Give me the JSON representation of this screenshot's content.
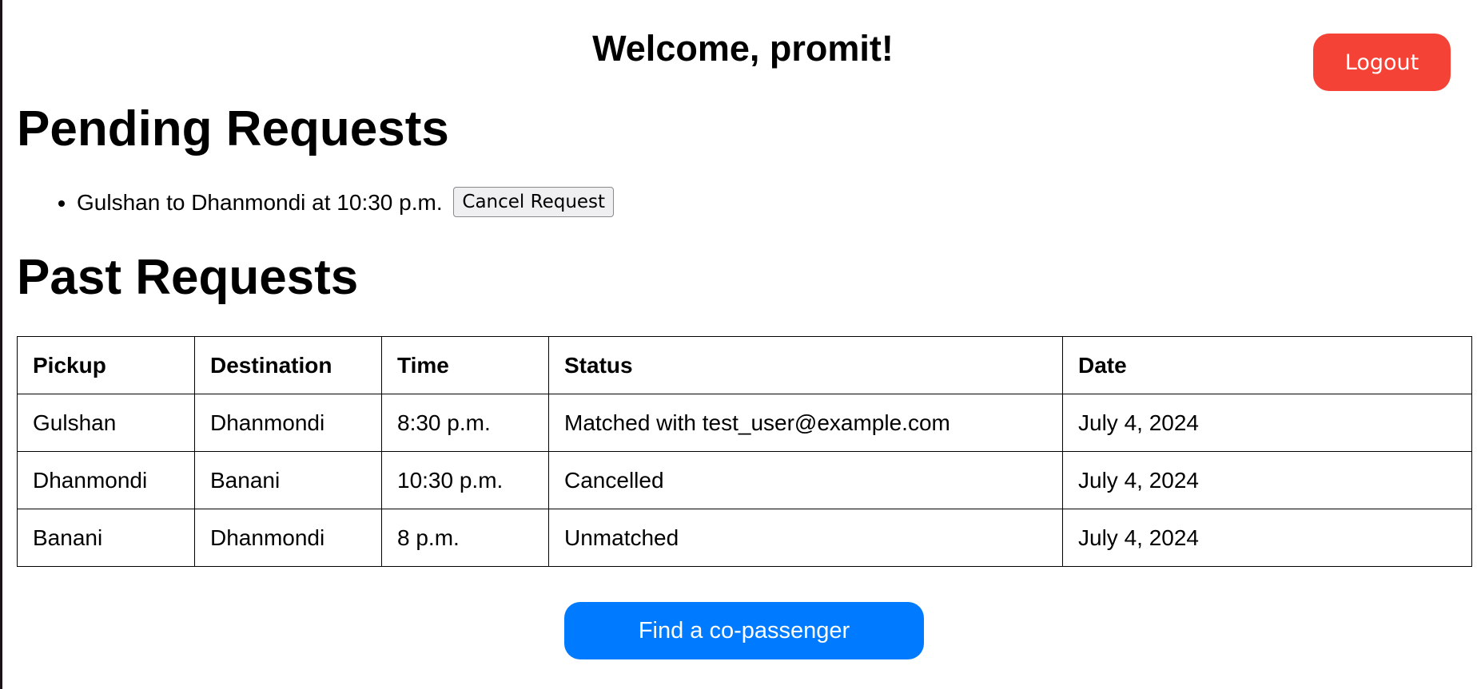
{
  "header": {
    "welcome": "Welcome, promit!",
    "logout_label": "Logout"
  },
  "pending": {
    "title": "Pending Requests",
    "items": [
      {
        "text": "Gulshan to Dhanmondi at 10:30 p.m.",
        "cancel_label": "Cancel Request"
      }
    ]
  },
  "past": {
    "title": "Past Requests",
    "columns": [
      "Pickup",
      "Destination",
      "Time",
      "Status",
      "Date"
    ],
    "rows": [
      [
        "Gulshan",
        "Dhanmondi",
        "8:30 p.m.",
        "Matched with test_user@example.com",
        "July 4, 2024"
      ],
      [
        "Dhanmondi",
        "Banani",
        "10:30 p.m.",
        "Cancelled",
        "July 4, 2024"
      ],
      [
        "Banani",
        "Dhanmondi",
        "8 p.m.",
        "Unmatched",
        "July 4, 2024"
      ]
    ]
  },
  "actions": {
    "find_label": "Find a co-passenger"
  },
  "colors": {
    "logout": "#f44336",
    "primary": "#007bff"
  }
}
